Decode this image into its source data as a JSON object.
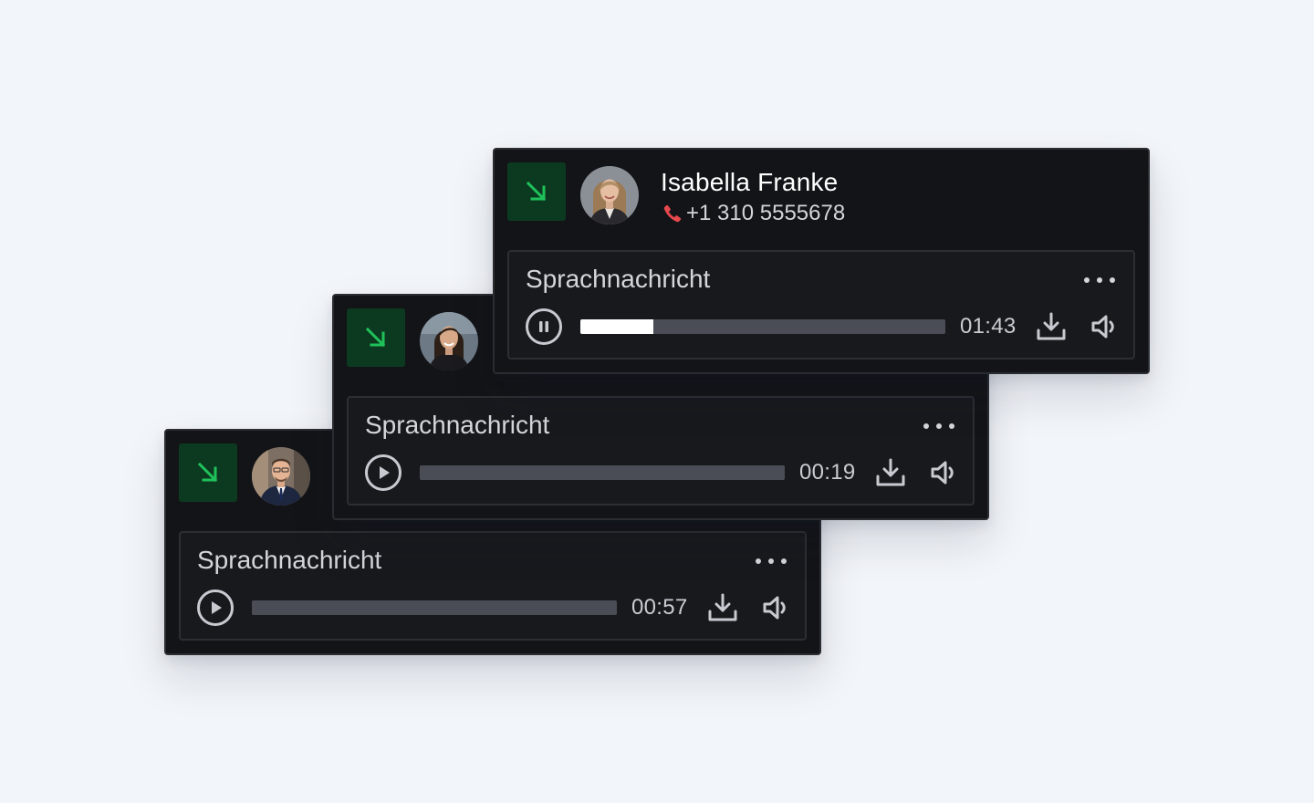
{
  "theme": {
    "background": "#f2f5f9",
    "card_bg": "#131417",
    "panel_bg": "#18191d",
    "badge_bg": "#0c3a20",
    "badge_icon": "#1fc15a",
    "phone_icon": "#e5484d",
    "progress_track": "#4a4d55",
    "progress_fill": "#ffffff"
  },
  "calls": [
    {
      "direction_icon": "arrow-down-right-icon",
      "contact": {
        "avatar": "avatar-man-suit"
      },
      "voicemail": {
        "title": "Sprachnachricht",
        "state": "paused",
        "duration": "00:57",
        "progress": 0,
        "more_icon": "more-horizontal-icon",
        "download_icon": "download-icon",
        "volume_icon": "volume-icon"
      }
    },
    {
      "direction_icon": "arrow-down-right-icon",
      "contact": {
        "avatar": "avatar-woman-dark-hair"
      },
      "voicemail": {
        "title": "Sprachnachricht",
        "state": "paused",
        "duration": "00:19",
        "progress": 0,
        "more_icon": "more-horizontal-icon",
        "download_icon": "download-icon",
        "volume_icon": "volume-icon"
      }
    },
    {
      "direction_icon": "arrow-down-right-icon",
      "contact": {
        "avatar": "avatar-woman-blonde",
        "name": "Isabella Franke",
        "phone": "+1 310 5555678",
        "phone_icon": "phone-icon"
      },
      "voicemail": {
        "title": "Sprachnachricht",
        "state": "playing",
        "duration": "01:43",
        "progress": 0.2,
        "more_icon": "more-horizontal-icon",
        "download_icon": "download-icon",
        "volume_icon": "volume-icon"
      }
    }
  ]
}
